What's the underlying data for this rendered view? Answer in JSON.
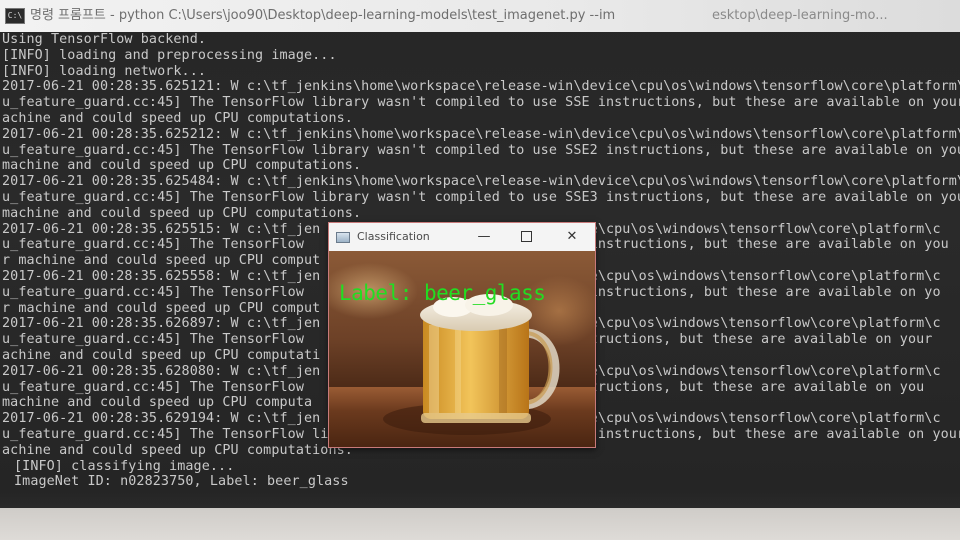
{
  "console_window": {
    "title_left": "명령 프롬프트 - python  C:\\Users\\joo90\\Desktop\\deep-learning-models\\test_imagenet.py --im",
    "title_right": "esktop\\deep-learning-mo...",
    "app_icon_text": "C:\\"
  },
  "console_lines": [
    "Using TensorFlow backend.",
    "[INFO] loading and preprocessing image...",
    "[INFO] loading network...",
    "2017-06-21 00:28:35.625121: W c:\\tf_jenkins\\home\\workspace\\release-win\\device\\cpu\\os\\windows\\tensorflow\\core\\platform\\c",
    "u_feature_guard.cc:45] The TensorFlow library wasn't compiled to use SSE instructions, but these are available on your",
    "achine and could speed up CPU computations.",
    "2017-06-21 00:28:35.625212: W c:\\tf_jenkins\\home\\workspace\\release-win\\device\\cpu\\os\\windows\\tensorflow\\core\\platform\\c",
    "u_feature_guard.cc:45] The TensorFlow library wasn't compiled to use SSE2 instructions, but these are available on you",
    "machine and could speed up CPU computations.",
    "2017-06-21 00:28:35.625484: W c:\\tf_jenkins\\home\\workspace\\release-win\\device\\cpu\\os\\windows\\tensorflow\\core\\platform\\c",
    "u_feature_guard.cc:45] The TensorFlow library wasn't compiled to use SSE3 instructions, but these are available on you",
    "machine and could speed up CPU computations.",
    "2017-06-21 00:28:35.625515: W c:\\tf_jen                             evice\\cpu\\os\\windows\\tensorflow\\core\\platform\\c",
    "u_feature_guard.cc:45] The TensorFlow                               4.1 instructions, but these are available on you",
    "r machine and could speed up CPU comput",
    "2017-06-21 00:28:35.625558: W c:\\tf_jen                             evice\\cpu\\os\\windows\\tensorflow\\core\\platform\\c",
    "u_feature_guard.cc:45] The TensorFlow                               4.2 instructions, but these are available on yo",
    "r machine and could speed up CPU comput",
    "2017-06-21 00:28:35.626897: W c:\\tf_jen                             evice\\cpu\\os\\windows\\tensorflow\\core\\platform\\c",
    "u_feature_guard.cc:45] The TensorFlow                                instructions, but these are available on your",
    "achine and could speed up CPU computati",
    "2017-06-21 00:28:35.628080: W c:\\tf_jen                             evice\\cpu\\os\\windows\\tensorflow\\core\\platform\\c",
    "u_feature_guard.cc:45] The TensorFlow                              2 instructions, but these are available on you",
    "machine and could speed up CPU computa",
    "2017-06-21 00:28:35.629194: W c:\\tf_jen                             evice\\cpu\\os\\windows\\tensorflow\\core\\platform\\c",
    "u_feature_guard.cc:45] The TensorFlow library wasn't compiled to use FMA instructions, but these are available on your r",
    "achine and could speed up CPU computations.",
    "[INFO] classifying image...",
    "ImageNet ID: n02823750, Label: beer_glass"
  ],
  "classification_window": {
    "title": "Classification",
    "minimize_glyph": "—",
    "close_glyph": "✕",
    "overlay_label": "Label: beer_glass",
    "image_subject": "beer-mug-photo"
  },
  "colors": {
    "console_background": "#262626",
    "console_text": "#c9c9c9",
    "overlay_label": "#22dd22"
  }
}
